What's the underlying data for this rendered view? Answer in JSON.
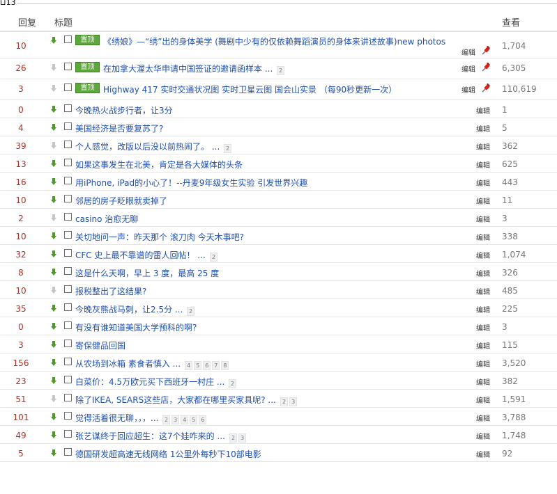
{
  "window_label": "⊔13",
  "header": {
    "replies": "回复",
    "title": "标题",
    "views": "查看"
  },
  "rows": [
    {
      "replies": "10",
      "arrow": "green",
      "badge": "置顶",
      "title": "《绣娘》—“绣”出的身体美学 (舞剧中少有的仅依赖舞蹈演员的身体来讲述故事)new photos",
      "edit": "编辑",
      "pinned": true,
      "views": "1,704"
    },
    {
      "replies": "26",
      "arrow": "gray",
      "badge": "置顶",
      "title": "在加拿大渥太华申请中国签证的邀请函样本 ...",
      "pages": [
        "2"
      ],
      "edit": "编辑",
      "pinned": true,
      "views": "6,305"
    },
    {
      "replies": "3",
      "arrow": "gray",
      "badge": "置顶",
      "title": "Highway 417 实时交通状况图 实时卫星云图 国会山实景 （每90秒更新一次）",
      "edit": "编辑",
      "pinned": true,
      "views": "110,619"
    },
    {
      "replies": "0",
      "arrow": "green",
      "title": "今晚热火战步行者，让3分",
      "edit": "编辑",
      "views": "1"
    },
    {
      "replies": "4",
      "arrow": "green",
      "title": "美国经济是否要复苏了?",
      "edit": "编辑",
      "views": "5"
    },
    {
      "replies": "39",
      "arrow": "gray",
      "title": "个人感觉，改版以后没以前热闹了。 ...",
      "pages": [
        "2"
      ],
      "edit": "编辑",
      "views": "362"
    },
    {
      "replies": "13",
      "arrow": "green",
      "title": "如果这事发生在北美，肯定是各大媒体的头条",
      "edit": "编辑",
      "views": "625"
    },
    {
      "replies": "16",
      "arrow": "green",
      "title": "用iPhone, iPad的小心了！--丹麦9年级女生实验 引发世界兴趣",
      "edit": "编辑",
      "views": "443"
    },
    {
      "replies": "10",
      "arrow": "green",
      "title": "邻居的房子眨眼就卖掉了",
      "edit": "编辑",
      "views": "11"
    },
    {
      "replies": "2",
      "arrow": "gray",
      "title": "casino 治愈无聊",
      "edit": "编辑",
      "views": "3"
    },
    {
      "replies": "10",
      "arrow": "green",
      "title": "关切地问一声：昨天那个 滚刀肉 今天木事吧?",
      "edit": "编辑",
      "views": "338"
    },
    {
      "replies": "32",
      "arrow": "green",
      "title": "CFC 史上最不靠谱的雷人回帖！ ...",
      "pages": [
        "2"
      ],
      "edit": "编辑",
      "views": "1,074"
    },
    {
      "replies": "8",
      "arrow": "green",
      "title": "这是什么天啊，早上 3 度，最高 25 度",
      "edit": "编辑",
      "views": "326"
    },
    {
      "replies": "10",
      "arrow": "gray",
      "title": "报税整出了这结果?",
      "edit": "编辑",
      "views": "485"
    },
    {
      "replies": "35",
      "arrow": "green",
      "title": "今晚灰熊战马刺，让2.5分 ...",
      "pages": [
        "2"
      ],
      "edit": "编辑",
      "views": "225"
    },
    {
      "replies": "0",
      "arrow": "green",
      "title": "有没有谁知道美国大学预科的啊?",
      "edit": "编辑",
      "views": "3"
    },
    {
      "replies": "3",
      "arrow": "green",
      "title": "寄保健品回国",
      "edit": "编辑",
      "views": "115"
    },
    {
      "replies": "156",
      "arrow": "green",
      "title": "从农场到冰箱 素食者慎入 ...",
      "pages": [
        "4",
        "5",
        "6",
        "7",
        "8"
      ],
      "edit": "编辑",
      "views": "3,520"
    },
    {
      "replies": "23",
      "arrow": "green",
      "title": "白菜价：4.5万欧元买下西班牙一村庄 ...",
      "pages": [
        "2"
      ],
      "edit": "编辑",
      "views": "382"
    },
    {
      "replies": "51",
      "arrow": "gray",
      "title": "除了IKEA, SEARS这些店，大家都在哪里买家具呢? ...",
      "pages": [
        "2",
        "3"
      ],
      "edit": "编辑",
      "views": "1,591"
    },
    {
      "replies": "101",
      "arrow": "green",
      "title": "觉得活着很无聊，，，...",
      "pages": [
        "2",
        "3",
        "4",
        "5",
        "6"
      ],
      "edit": "编辑",
      "views": "3,788"
    },
    {
      "replies": "49",
      "arrow": "green",
      "title": "张艺谋终于回应超生：这7个娃咋来的 ...",
      "pages": [
        "2",
        "3"
      ],
      "edit": "编辑",
      "views": "1,748"
    },
    {
      "replies": "5",
      "arrow": "green",
      "title": "德国研发超高速无线网络 1公里外每秒下10部电影",
      "edit": "编辑",
      "views": "92"
    }
  ]
}
